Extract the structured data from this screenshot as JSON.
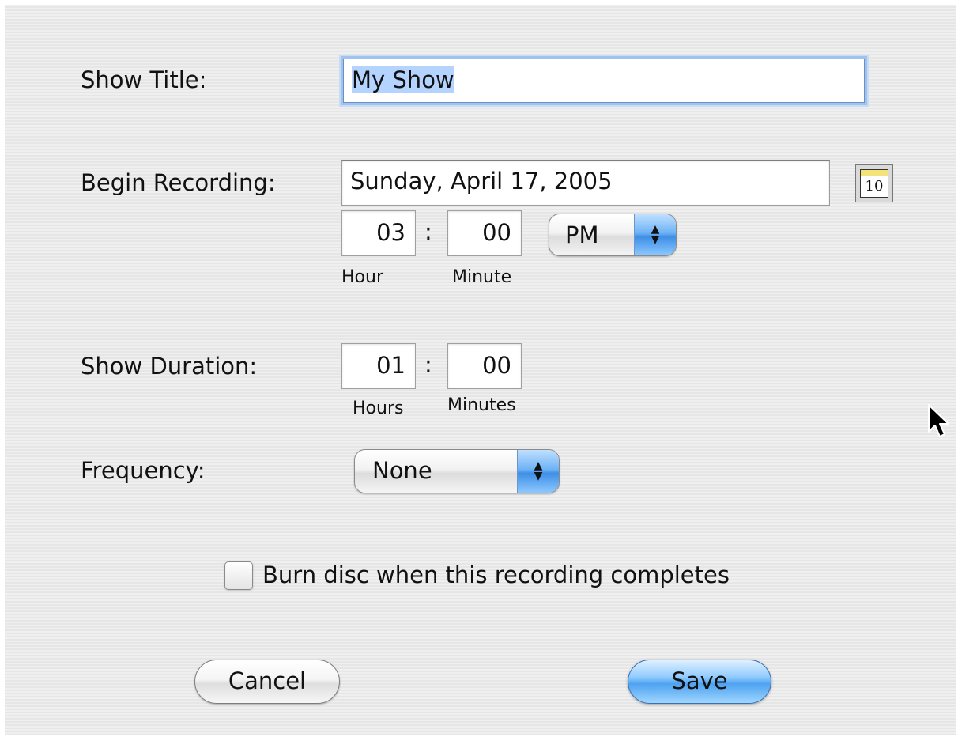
{
  "show_title": {
    "label": "Show Title:",
    "value": "My Show"
  },
  "begin_recording": {
    "label": "Begin Recording:",
    "date": "Sunday, April 17, 2005",
    "calendar_day": "10",
    "hour": "03",
    "separator": ":",
    "minute": "00",
    "ampm": "PM",
    "hour_label": "Hour",
    "minute_label": "Minute"
  },
  "show_duration": {
    "label": "Show Duration:",
    "hours": "01",
    "separator": ":",
    "minutes": "00",
    "hours_label": "Hours",
    "minutes_label": "Minutes"
  },
  "frequency": {
    "label": "Frequency:",
    "value": "None"
  },
  "burn_disc": {
    "label": "Burn disc when this recording completes",
    "checked": false
  },
  "buttons": {
    "cancel": "Cancel",
    "save": "Save"
  }
}
